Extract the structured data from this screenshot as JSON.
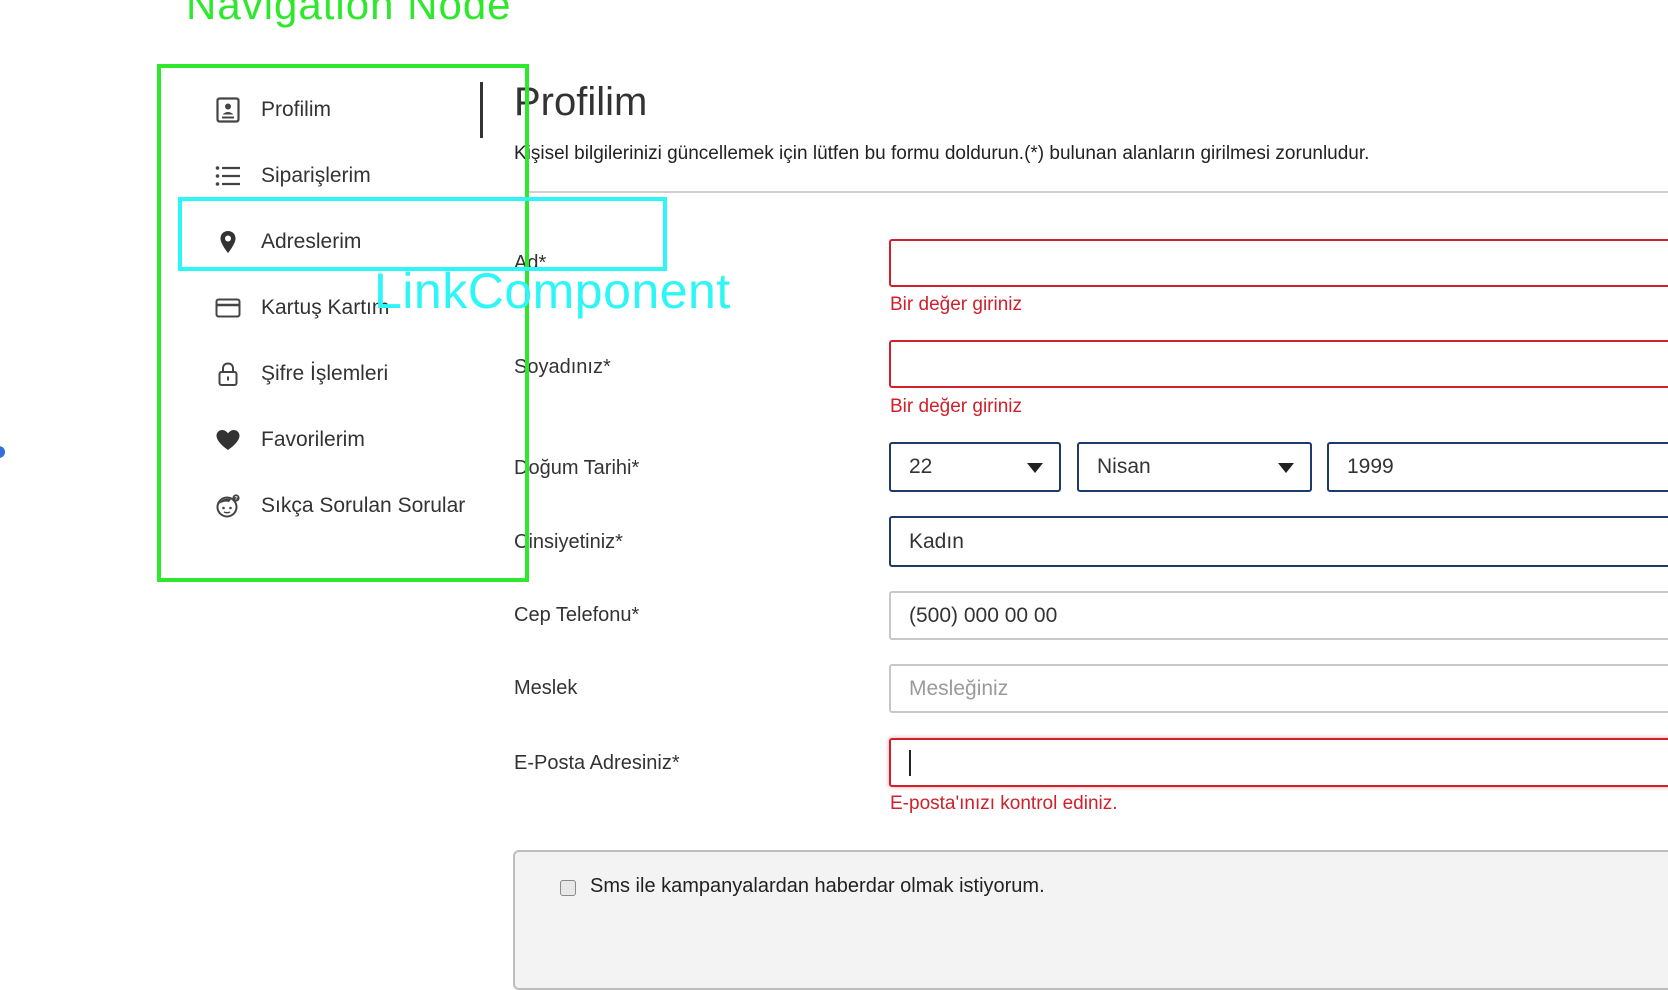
{
  "annotations": {
    "navigation_node_label": "Navigation Node",
    "link_component_label": "LinkComponent",
    "colors": {
      "navigation_node": "#2ee82e",
      "link_component": "#2ff6f6"
    }
  },
  "sidebar": {
    "items": [
      {
        "label": "Profilim",
        "icon": "profile-card-icon",
        "active": true
      },
      {
        "label": "Siparişlerim",
        "icon": "list-icon"
      },
      {
        "label": "Adreslerim",
        "icon": "location-pin-icon"
      },
      {
        "label": "Kartuş Kartım",
        "icon": "credit-card-icon"
      },
      {
        "label": "Şifre İşlemleri",
        "icon": "lock-icon"
      },
      {
        "label": "Favorilerim",
        "icon": "heart-icon"
      },
      {
        "label": "Sıkça Sorulan Sorular",
        "icon": "faq-face-icon"
      }
    ]
  },
  "main": {
    "title": "Profilim",
    "description": "Kişisel bilgilerinizi güncellemek için lütfen bu formu doldurun.(*) bulunan alanların girilmesi zorunludur.",
    "form": {
      "first_name": {
        "label": "Ad*",
        "value": "",
        "error": "Bir değer giriniz"
      },
      "last_name": {
        "label": "Soyadınız*",
        "value": "",
        "error": "Bir değer giriniz"
      },
      "birth_date": {
        "label": "Doğum Tarihi*",
        "day": "22",
        "month": "Nisan",
        "year": "1999"
      },
      "gender": {
        "label": "Cinsiyetiniz*",
        "value": "Kadın"
      },
      "phone": {
        "label": "Cep Telefonu*",
        "value": "(500) 000 00 00"
      },
      "job": {
        "label": "Meslek",
        "placeholder": "Mesleğiniz"
      },
      "email": {
        "label": "E-Posta Adresiniz*",
        "value": "",
        "error": "E-posta'ınızı kontrol ediniz."
      },
      "sms_opt_in": {
        "label": "Sms ile kampanyalardan haberdar olmak istiyorum.",
        "checked": false
      }
    }
  },
  "colors": {
    "error": "#d0202a",
    "focus_border": "#1d3b68",
    "text": "#333333"
  }
}
